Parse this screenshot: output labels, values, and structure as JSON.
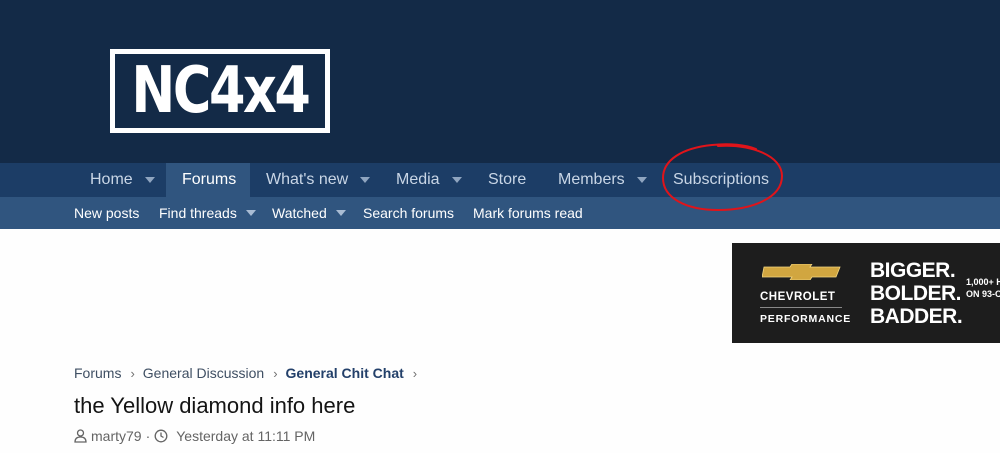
{
  "logo": {
    "text": "NC4x4"
  },
  "nav": {
    "items": [
      {
        "label": "Home",
        "has_dropdown": true
      },
      {
        "label": "Forums",
        "active": true
      },
      {
        "label": "What's new",
        "has_dropdown": true
      },
      {
        "label": "Media",
        "has_dropdown": true
      },
      {
        "label": "Store"
      },
      {
        "label": "Members",
        "has_dropdown": true
      },
      {
        "label": "Subscriptions"
      }
    ]
  },
  "subnav": {
    "items": [
      {
        "label": "New posts"
      },
      {
        "label": "Find threads",
        "has_dropdown": true
      },
      {
        "label": "Watched",
        "has_dropdown": true
      },
      {
        "label": "Search forums"
      },
      {
        "label": "Mark forums read"
      }
    ]
  },
  "ad": {
    "brand": "CHEVROLET",
    "sub_brand": "PERFORMANCE",
    "lines": [
      "BIGGER.",
      "BOLDER.",
      "BADDER."
    ],
    "small_lines": [
      "1,000+ H",
      "ON 93-O"
    ]
  },
  "breadcrumb": [
    "Forums",
    "General Discussion",
    "General Chit Chat"
  ],
  "thread": {
    "title": "the Yellow diamond info here",
    "author": "marty79",
    "separator": "·",
    "posted": "Yesterday at 11:11 PM"
  },
  "colors": {
    "header_bg": "#132a47",
    "nav_bg": "#1c3d66",
    "subnav_bg": "#30557f",
    "annotation": "#e0141a",
    "bowtie_gold": "#d1a640"
  }
}
